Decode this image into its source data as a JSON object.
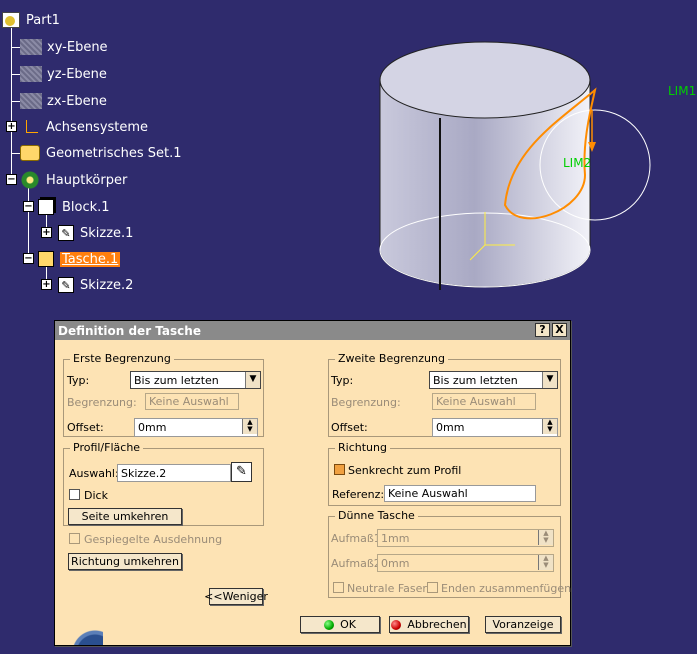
{
  "tree": {
    "root": "Part1",
    "items": [
      {
        "label": "xy-Ebene"
      },
      {
        "label": "yz-Ebene"
      },
      {
        "label": "zx-Ebene"
      },
      {
        "label": "Achsensysteme"
      },
      {
        "label": "Geometrisches Set.1"
      },
      {
        "label": "Hauptkörper"
      },
      {
        "label": "Block.1"
      },
      {
        "label": "Skizze.1"
      },
      {
        "label": "Tasche.1"
      },
      {
        "label": "Skizze.2"
      }
    ]
  },
  "scene": {
    "labels": [
      "LIM1",
      "LIM2"
    ],
    "colors": {
      "background": "#2f2b6d",
      "profile": "#ff8c00",
      "limit_label": "#00d000"
    }
  },
  "dialog": {
    "title": "Definition der Tasche",
    "help_btn": "?",
    "close_btn": "X",
    "first_limit": {
      "title": "Erste Begrenzung",
      "type_label": "Typ:",
      "type_value": "Bis zum letzten",
      "limit_label": "Begrenzung:",
      "limit_value": "Keine Auswahl",
      "offset_label": "Offset:",
      "offset_value": "0mm"
    },
    "second_limit": {
      "title": "Zweite Begrenzung",
      "type_label": "Typ:",
      "type_value": "Bis zum letzten",
      "limit_label": "Begrenzung:",
      "limit_value": "Keine Auswahl",
      "offset_label": "Offset:",
      "offset_value": "0mm"
    },
    "profile": {
      "title": "Profil/Fläche",
      "selection_label": "Auswahl:",
      "selection_value": "Skizze.2",
      "thick_label": "Dick",
      "reverse_side_btn": "Seite umkehren"
    },
    "mirrored_label": "Gespiegelte Ausdehnung",
    "reverse_direction_btn": "Richtung umkehren",
    "less_btn": "<<Weniger",
    "direction": {
      "title": "Richtung",
      "normal_label": "Senkrecht zum Profil",
      "reference_label": "Referenz:",
      "reference_value": "Keine Auswahl"
    },
    "thin": {
      "title": "Dünne Tasche",
      "thickness1_label": "Aufmaß1",
      "thickness1_value": "1mm",
      "thickness2_label": "Aufmaß2:",
      "thickness2_value": "0mm",
      "neutral_label": "Neutrale Faser",
      "merge_label": "Enden zusammenfügen"
    },
    "ok_btn": "OK",
    "cancel_btn": "Abbrechen",
    "preview_btn": "Voranzeige"
  }
}
